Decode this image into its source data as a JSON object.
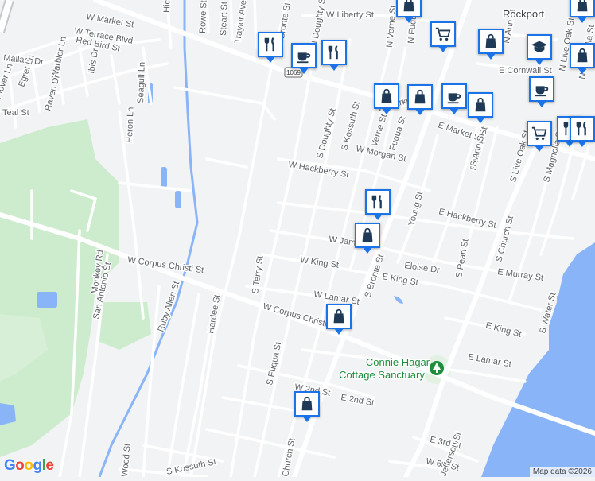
{
  "map": {
    "colors": {
      "land": "#f1f3f4",
      "park": "#cdeccd",
      "water": "#8ab4f8",
      "road": "#ffffff",
      "highway": "#c4c8cc",
      "pin_border": "#1a73e8",
      "pin_icon": "#1f3a57",
      "park_label": "#1e8e3e"
    },
    "town_label": "Rockport",
    "park_label_line1": "Connie Hagar",
    "park_label_line2": "Cottage Sanctuary",
    "highway_shield": "1069",
    "attribution": "Map data ©2026",
    "logo": "Google",
    "street_labels": [
      "W Market St",
      "W Liberty St",
      "W Terrace Blvd",
      "Red Bird St",
      "Mallard Dr",
      "Plover Ln",
      "Egret Ln",
      "Ibis Dr",
      "Warbler Ln",
      "Raven Dr",
      "Teal St",
      "Heron Ln",
      "Seagull Ln",
      "Hickory",
      "Rowe St",
      "Steart St",
      "Traylor Ave",
      "N Bronte St",
      "N Doughty St",
      "N Verne St",
      "N Fuqua St",
      "N Ann St",
      "N Live Oak St",
      "N Magnolia St",
      "E Cornwall St",
      "W Market St",
      "E Market St",
      "S Doughty St",
      "S Kossuth St",
      "S Verne St",
      "S Fuqua St",
      "W Morgan St",
      "W Hackberry St",
      "E Hackberry St",
      "Young St",
      "S Mathis St",
      "S Ann St",
      "S Church St",
      "S Live Oak St",
      "S Magnolia St",
      "W James St",
      "W King St",
      "E King St",
      "Eloise Dr",
      "S Pearl St",
      "E Murray St",
      "S Bronte St",
      "W Corpus Christi St",
      "W Corpus Christi",
      "W Lamar St",
      "E Lamar St",
      "S Terry St",
      "Monkey Rd",
      "San Antonio St",
      "Ruby Allen St",
      "Hardee St",
      "S Water St",
      "E King St",
      "W 2nd St",
      "E 2nd St",
      "E 3rd St",
      "W 6th St",
      "S Kossuth St",
      "S Fuqua St",
      "Church St",
      "Jefferson St",
      "Wood St"
    ],
    "markers": [
      {
        "name": "shopping-bag-icon"
      },
      {
        "name": "restaurant-icon"
      },
      {
        "name": "cafe-icon"
      },
      {
        "name": "restaurant-icon"
      },
      {
        "name": "grocery-cart-icon"
      },
      {
        "name": "shopping-bag-icon"
      },
      {
        "name": "school-icon"
      },
      {
        "name": "shopping-bag-icon"
      },
      {
        "name": "shopping-bag-icon"
      },
      {
        "name": "cafe-icon"
      },
      {
        "name": "shopping-bag-icon"
      },
      {
        "name": "cafe-icon"
      },
      {
        "name": "restaurant-icon"
      },
      {
        "name": "grocery-cart-icon"
      },
      {
        "name": "restaurant-icon"
      },
      {
        "name": "restaurant-icon"
      },
      {
        "name": "shopping-bag-icon"
      },
      {
        "name": "shopping-bag-icon"
      },
      {
        "name": "shopping-bag-icon"
      }
    ]
  }
}
